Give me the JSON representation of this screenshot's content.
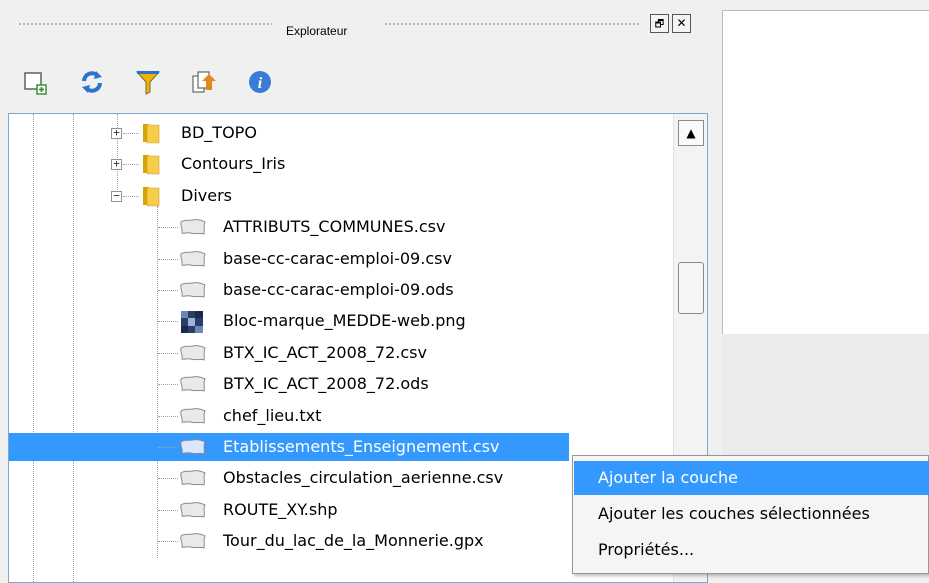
{
  "dock": {
    "title": "Explorateur",
    "float_glyph": "🗗",
    "close_glyph": "✕"
  },
  "toolbar": {
    "icons": [
      "add-layer-icon",
      "refresh-icon",
      "filter-icon",
      "collapse-all-icon",
      "info-icon"
    ]
  },
  "tree": {
    "folders": [
      {
        "label": "BD_TOPO",
        "expanded": false,
        "expander": "+"
      },
      {
        "label": "Contours_Iris",
        "expanded": false,
        "expander": "+"
      },
      {
        "label": "Divers",
        "expanded": true,
        "expander": "−"
      }
    ],
    "files": [
      {
        "label": "ATTRIBUTS_COMMUNES.csv",
        "icon": "vector-layer-icon"
      },
      {
        "label": "base-cc-carac-emploi-09.csv",
        "icon": "vector-layer-icon"
      },
      {
        "label": "base-cc-carac-emploi-09.ods",
        "icon": "vector-layer-icon"
      },
      {
        "label": "Bloc-marque_MEDDE-web.png",
        "icon": "raster-layer-icon"
      },
      {
        "label": "BTX_IC_ACT_2008_72.csv",
        "icon": "vector-layer-icon"
      },
      {
        "label": "BTX_IC_ACT_2008_72.ods",
        "icon": "vector-layer-icon"
      },
      {
        "label": "chef_lieu.txt",
        "icon": "vector-layer-icon"
      },
      {
        "label": "Etablissements_Enseignement.csv",
        "icon": "vector-layer-icon",
        "selected": true
      },
      {
        "label": "Obstacles_circulation_aerienne.csv",
        "icon": "vector-layer-icon"
      },
      {
        "label": "ROUTE_XY.shp",
        "icon": "vector-layer-icon"
      },
      {
        "label": "Tour_du_lac_de_la_Monnerie.gpx",
        "icon": "vector-layer-icon"
      }
    ]
  },
  "scrollbar": {
    "up_arrow": "▲"
  },
  "context_menu": {
    "items": [
      {
        "label": "Ajouter la couche",
        "active": true
      },
      {
        "label": "Ajouter les couches sélectionnées",
        "active": false
      },
      {
        "label": "Propriétés...",
        "active": false
      }
    ]
  },
  "colors": {
    "selection": "#3399ff",
    "tree_border": "#7aa7d8",
    "folder": "#f2c94c"
  }
}
